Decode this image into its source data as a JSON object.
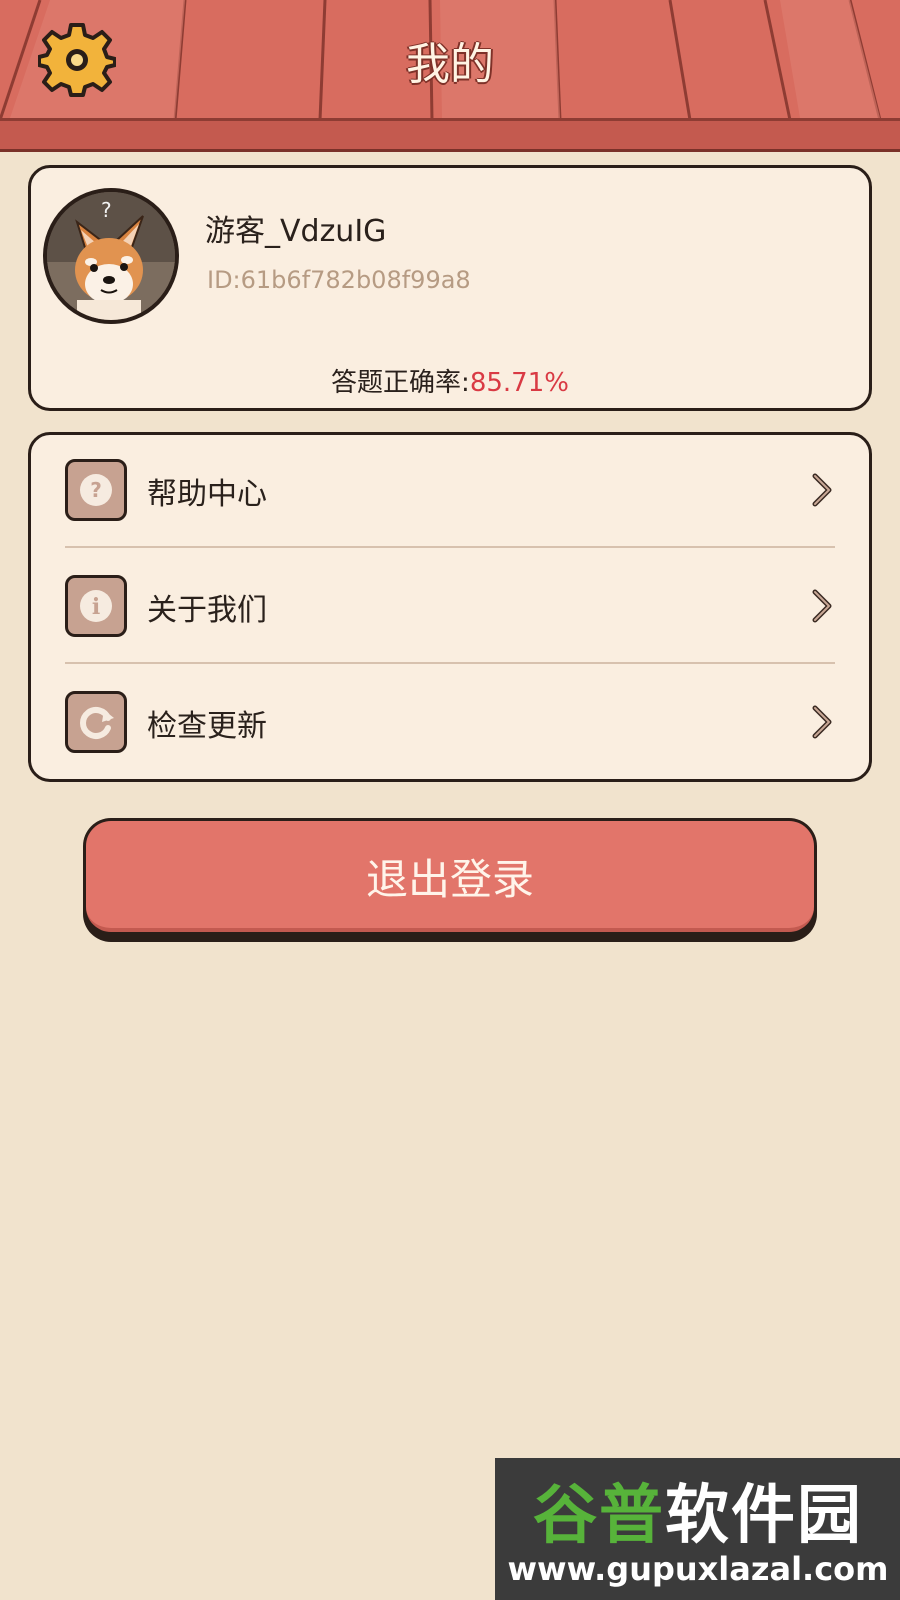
{
  "header": {
    "title": "我的",
    "settings_icon": "gear-icon",
    "colors": {
      "wood": "#d86c5f",
      "gear": "#f2b33b"
    }
  },
  "profile": {
    "username": "游客_VdzuIG",
    "id_text": "ID:61b6f782b08f99a8",
    "accuracy_label": "答题正确率:",
    "accuracy_value": "85.71%",
    "avatar_icon": "shiba-dog-avatar",
    "avatar_mark": "?"
  },
  "menu": {
    "items": [
      {
        "label": "帮助中心",
        "icon": "question-icon",
        "glyph": "?"
      },
      {
        "label": "关于我们",
        "icon": "info-icon",
        "glyph": "i"
      },
      {
        "label": "检查更新",
        "icon": "refresh-icon",
        "glyph": ""
      }
    ],
    "chevron_icon": "chevron-right-icon"
  },
  "logout": {
    "label": "退出登录",
    "color": "#e2756a"
  },
  "watermark": {
    "brand_green": "谷普",
    "brand_white": "软件园",
    "url": "www.gupuxlazal.com"
  }
}
